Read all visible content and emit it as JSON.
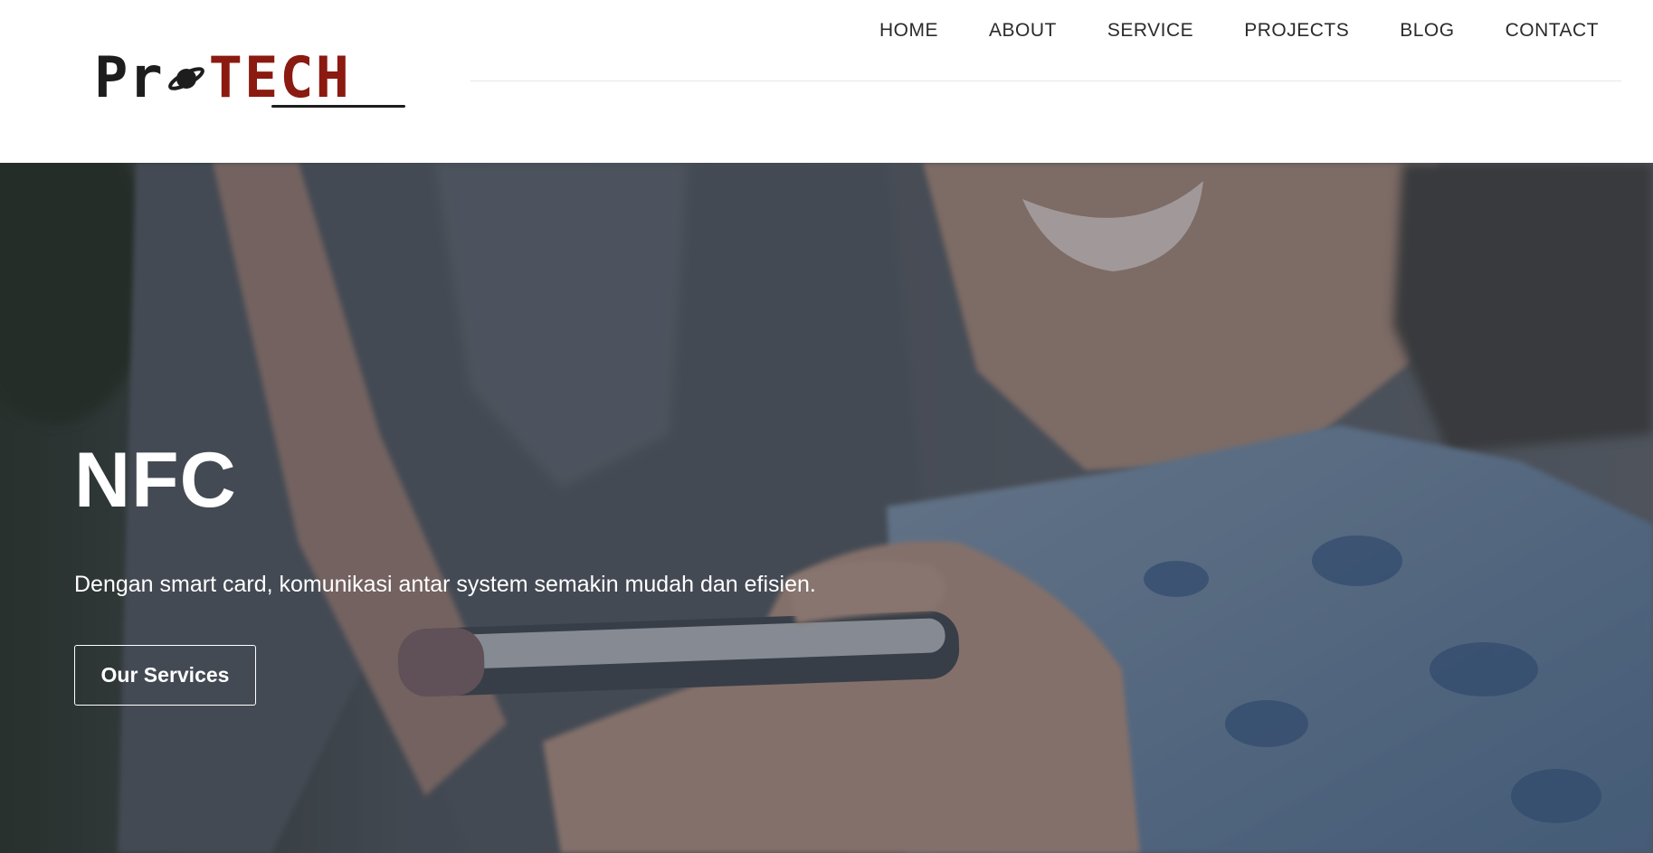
{
  "logo": {
    "text_dark": "Pr",
    "text_accent": "TECH",
    "brand_dark": "#1d1d1d",
    "brand_red": "#8b1a10"
  },
  "nav": {
    "items": [
      "HOME",
      "ABOUT",
      "SERVICE",
      "PROJECTS",
      "BLOG",
      "CONTACT"
    ]
  },
  "hero": {
    "title": "NFC",
    "subtitle": "Dengan smart card, komunikasi antar system semakin mudah dan efisien.",
    "button_label": "Our Services"
  }
}
